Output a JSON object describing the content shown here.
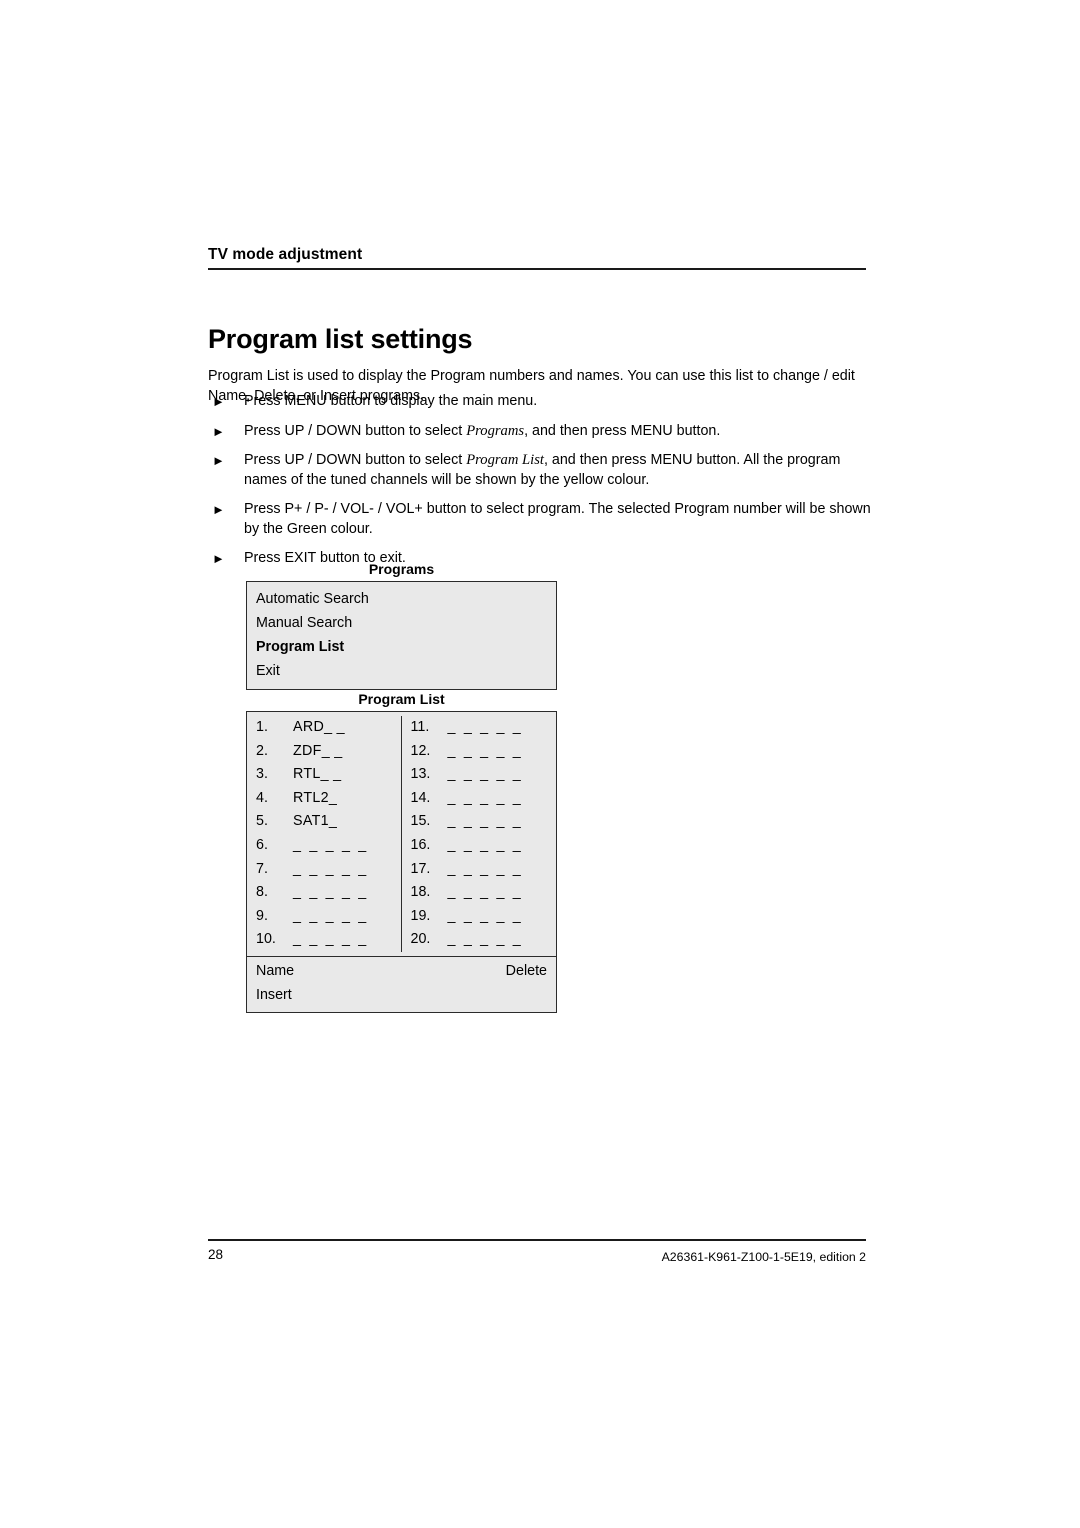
{
  "header": {
    "running_title": "TV mode adjustment"
  },
  "page_title": "Program list settings",
  "intro": "Program List is used to display the Program numbers and names. You can use this list to change / edit Name, Delete, or Insert programs.",
  "bullets": [
    {
      "marker": "►",
      "parts": [
        {
          "text": "Press MENU button to display the main menu.",
          "style": "normal"
        }
      ]
    },
    {
      "marker": "►",
      "parts": [
        {
          "text": "Press UP / DOWN button to select ",
          "style": "normal"
        },
        {
          "text": "Programs",
          "style": "italic"
        },
        {
          "text": ", and then press MENU button.",
          "style": "normal"
        }
      ]
    },
    {
      "marker": "►",
      "parts": [
        {
          "text": "Press UP / DOWN button to select ",
          "style": "normal"
        },
        {
          "text": "Program List",
          "style": "italic"
        },
        {
          "text": ", and then press MENU button. All the program names of the tuned channels will be shown by the yellow colour.",
          "style": "normal"
        }
      ]
    },
    {
      "marker": "►",
      "parts": [
        {
          "text": "Press P+ / P- / VOL- / VOL+ button to select program. The selected Program number will be shown by the Green colour.",
          "style": "normal"
        }
      ]
    },
    {
      "marker": "►",
      "parts": [
        {
          "text": "Press EXIT button to exit.",
          "style": "normal"
        }
      ]
    }
  ],
  "programs_menu": {
    "caption": "Programs",
    "items": [
      {
        "label": "Automatic Search",
        "selected": false
      },
      {
        "label": "Manual Search",
        "selected": false
      },
      {
        "label": "Program List",
        "selected": true
      },
      {
        "label": "Exit",
        "selected": false
      }
    ]
  },
  "program_list": {
    "caption": "Program List",
    "blank_name": "_ _ _ _ _",
    "left_column": [
      {
        "number": "1.",
        "name": "ARD_ _",
        "blank": false
      },
      {
        "number": "2.",
        "name": "ZDF_ _",
        "blank": false
      },
      {
        "number": "3.",
        "name": "RTL_ _",
        "blank": false
      },
      {
        "number": "4.",
        "name": "RTL2_",
        "blank": false
      },
      {
        "number": "5.",
        "name": "SAT1_",
        "blank": false
      },
      {
        "number": "6.",
        "name": "_ _ _ _ _",
        "blank": true
      },
      {
        "number": "7.",
        "name": "_ _ _ _ _",
        "blank": true
      },
      {
        "number": "8.",
        "name": "_ _ _ _ _",
        "blank": true
      },
      {
        "number": "9.",
        "name": "_ _ _ _ _",
        "blank": true
      },
      {
        "number": "10.",
        "name": "_ _ _ _ _",
        "blank": true
      }
    ],
    "right_column": [
      {
        "number": "11.",
        "name": "_ _ _ _ _",
        "blank": true
      },
      {
        "number": "12.",
        "name": "_ _ _ _ _",
        "blank": true
      },
      {
        "number": "13.",
        "name": "_ _ _ _ _",
        "blank": true
      },
      {
        "number": "14.",
        "name": "_ _ _ _ _",
        "blank": true
      },
      {
        "number": "15.",
        "name": "_ _ _ _ _",
        "blank": true
      },
      {
        "number": "16.",
        "name": "_ _ _ _ _",
        "blank": true
      },
      {
        "number": "17.",
        "name": "_ _ _ _ _",
        "blank": true
      },
      {
        "number": "18.",
        "name": "_ _ _ _ _",
        "blank": true
      },
      {
        "number": "19.",
        "name": "_ _ _ _ _",
        "blank": true
      },
      {
        "number": "20.",
        "name": "_ _ _ _ _",
        "blank": true
      }
    ],
    "actions": {
      "name": "Name",
      "delete": "Delete",
      "insert": "Insert"
    }
  },
  "footer": {
    "page_number": "28",
    "document_code": "A26361-K961-Z100-1-5E19, edition 2"
  },
  "colors": {
    "osd_background": "#e9e9e9",
    "osd_border": "#2b2b2b",
    "rule": "#1a1a1a",
    "text": "#000000"
  }
}
